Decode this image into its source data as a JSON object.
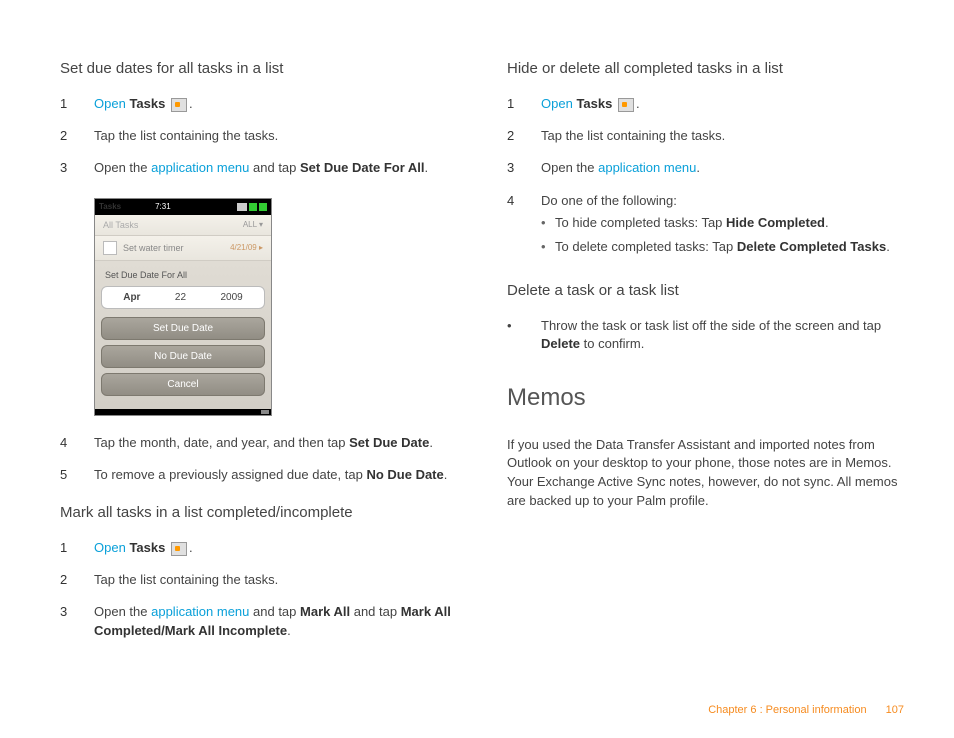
{
  "left": {
    "sec1": {
      "heading": "Set due dates for all tasks in a list",
      "s1_open": "Open",
      "s1_tasks": "Tasks",
      "s1_period": ".",
      "s2": "Tap the list containing the tasks.",
      "s3a": "Open the ",
      "s3_link": "application menu",
      "s3b": " and tap ",
      "s3_bold": "Set Due Date For All",
      "s3c": ".",
      "s4a": "Tap the month, date, and year, and then tap ",
      "s4_bold": "Set Due Date",
      "s4b": ".",
      "s5a": "To remove a previously assigned due date, tap ",
      "s5_bold": "No Due Date",
      "s5b": "."
    },
    "sec2": {
      "heading": "Mark all tasks in a list completed/incomplete",
      "s1_open": "Open",
      "s1_tasks": "Tasks",
      "s1_period": ".",
      "s2": "Tap the list containing the tasks.",
      "s3a": "Open the ",
      "s3_link": "application menu",
      "s3b": " and tap ",
      "s3_bold1": "Mark All",
      "s3c": " and tap ",
      "s3_bold2": "Mark All Completed/Mark All Incomplete",
      "s3d": "."
    },
    "phone": {
      "app": "Tasks",
      "time": "7:31",
      "hdr_left": "All Tasks",
      "hdr_right": "ALL ▾",
      "task_name": "Set water timer",
      "task_date": "4/21/09 ▸",
      "panel_title": "Set Due Date For All",
      "month": "Apr",
      "day": "22",
      "year": "2009",
      "btn1": "Set Due Date",
      "btn2": "No Due Date",
      "btn3": "Cancel"
    }
  },
  "right": {
    "sec1": {
      "heading": "Hide or delete all completed tasks in a list",
      "s1_open": "Open",
      "s1_tasks": "Tasks",
      "s1_period": ".",
      "s2": "Tap the list containing the tasks.",
      "s3a": "Open the ",
      "s3_link": "application menu",
      "s3b": ".",
      "s4": "Do one of the following:",
      "b1a": "To hide completed tasks: Tap ",
      "b1_bold": "Hide Completed",
      "b1b": ".",
      "b2a": "To delete completed tasks: Tap ",
      "b2_bold": "Delete Completed Tasks",
      "b2b": "."
    },
    "sec2": {
      "heading": "Delete a task or a task list",
      "bul_a": "Throw the task or task list off the side of the screen and tap ",
      "bul_bold": "Delete",
      "bul_b": " to confirm."
    },
    "memos": {
      "heading": "Memos",
      "body": "If you used the Data Transfer Assistant and imported notes from Outlook on your desktop to your phone, those notes are in Memos. Your Exchange Active Sync notes, however, do not sync. All memos are backed up to your Palm profile."
    }
  },
  "footer": {
    "chapter": "Chapter 6  :  Personal information",
    "page": "107"
  },
  "nums": {
    "n1": "1",
    "n2": "2",
    "n3": "3",
    "n4": "4",
    "n5": "5"
  }
}
